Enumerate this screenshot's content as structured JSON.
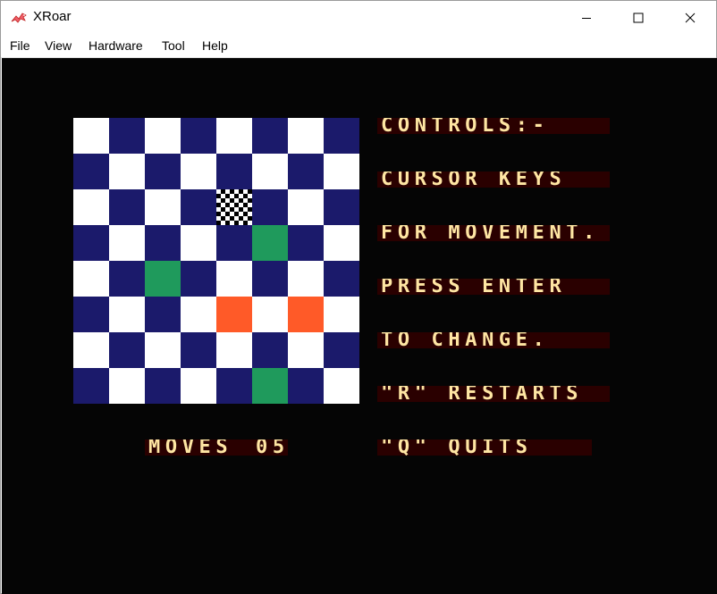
{
  "window": {
    "title": "XRoar",
    "icon": "xroar-dragon-icon",
    "controls": [
      "minimize-icon",
      "maximize-icon",
      "close-icon"
    ]
  },
  "menu": [
    "File",
    "View",
    "Hardware",
    "Tool",
    "Help"
  ],
  "colors": {
    "screen_bg": "#050505",
    "board_light": "#ffffff",
    "board_dark": "#1b1a6b",
    "green": "#1f9a5c",
    "orange": "#ff5a28",
    "text": "#ffe6a3",
    "text_band": "#2a0000"
  },
  "board": {
    "size": 8,
    "cursor": [
      2,
      4
    ],
    "special": [
      {
        "row": 3,
        "col": 5,
        "color": "green"
      },
      {
        "row": 4,
        "col": 2,
        "color": "green"
      },
      {
        "row": 5,
        "col": 4,
        "color": "orange"
      },
      {
        "row": 5,
        "col": 6,
        "color": "orange"
      },
      {
        "row": 7,
        "col": 5,
        "color": "green"
      }
    ]
  },
  "game": {
    "controls": [
      "CONTROLS:-",
      "CURSOR KEYS",
      "FOR MOVEMENT.",
      "PRESS ENTER",
      "TO CHANGE.",
      "\"R\" RESTARTS",
      "\"Q\" QUITS"
    ],
    "moves_label": "MOVES",
    "moves": "05"
  }
}
